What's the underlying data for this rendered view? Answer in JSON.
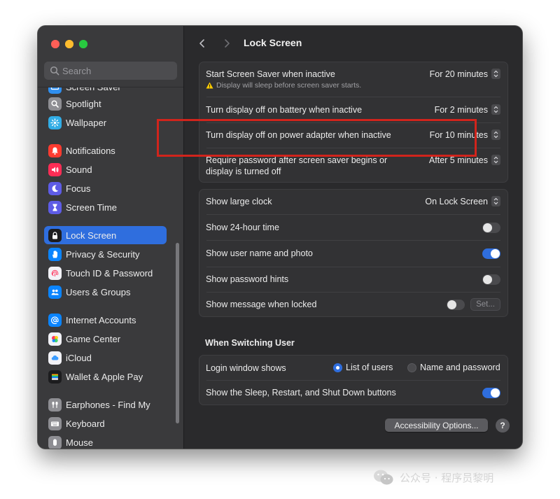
{
  "sidebar": {
    "search_placeholder": "Search",
    "items": [
      {
        "label": "Screen Saver",
        "icon": "screen-saver-icon",
        "color": "#2f8ff0"
      },
      {
        "label": "Spotlight",
        "icon": "spotlight-icon",
        "color": "#8e8e93"
      },
      {
        "label": "Wallpaper",
        "icon": "wallpaper-icon",
        "color": "#32ade6"
      },
      {
        "label": "Notifications",
        "icon": "bell-icon",
        "color": "#ff3b30"
      },
      {
        "label": "Sound",
        "icon": "speaker-icon",
        "color": "#ff2d55"
      },
      {
        "label": "Focus",
        "icon": "moon-icon",
        "color": "#5e5ce6"
      },
      {
        "label": "Screen Time",
        "icon": "hourglass-icon",
        "color": "#5e5ce6"
      },
      {
        "label": "Lock Screen",
        "icon": "lock-icon",
        "color": "#1c1c1e"
      },
      {
        "label": "Privacy & Security",
        "icon": "hand-icon",
        "color": "#0a84ff"
      },
      {
        "label": "Touch ID & Password",
        "icon": "fingerprint-icon",
        "color": "#f2f2f7"
      },
      {
        "label": "Users & Groups",
        "icon": "users-icon",
        "color": "#0a84ff"
      },
      {
        "label": "Internet Accounts",
        "icon": "at-icon",
        "color": "#0a84ff"
      },
      {
        "label": "Game Center",
        "icon": "game-center-icon",
        "color": "#f2f2f7"
      },
      {
        "label": "iCloud",
        "icon": "cloud-icon",
        "color": "#f2f2f7"
      },
      {
        "label": "Wallet & Apple Pay",
        "icon": "wallet-icon",
        "color": "#1c1c1e"
      },
      {
        "label": "Earphones - Find My",
        "icon": "earphones-icon",
        "color": "#8e8e93"
      },
      {
        "label": "Keyboard",
        "icon": "keyboard-icon",
        "color": "#8e8e93"
      },
      {
        "label": "Mouse",
        "icon": "mouse-icon",
        "color": "#8e8e93"
      }
    ]
  },
  "header": {
    "title": "Lock Screen"
  },
  "group1": {
    "screen_saver": {
      "label": "Start Screen Saver when inactive",
      "warning": "Display will sleep before screen saver starts.",
      "value": "For 20 minutes"
    },
    "battery": {
      "label": "Turn display off on battery when inactive",
      "value": "For 2 minutes"
    },
    "adapter": {
      "label": "Turn display off on power adapter when inactive",
      "value": "For 10 minutes"
    },
    "password": {
      "label_line1": "Require password after screen saver begins or",
      "label_line2": "display is turned off",
      "value": "After 5 minutes"
    }
  },
  "group2": {
    "large_clock": {
      "label": "Show large clock",
      "value": "On Lock Screen"
    },
    "hour24": {
      "label": "Show 24-hour time",
      "on": false
    },
    "user_photo": {
      "label": "Show user name and photo",
      "on": true
    },
    "hints": {
      "label": "Show password hints",
      "on": false
    },
    "message": {
      "label": "Show message when locked",
      "on": false,
      "button": "Set..."
    }
  },
  "switching": {
    "title": "When Switching User",
    "login_window": {
      "label": "Login window shows",
      "option1": "List of users",
      "option2": "Name and password",
      "selected": "option1"
    },
    "buttons": {
      "label": "Show the Sleep, Restart, and Shut Down buttons",
      "on": true
    }
  },
  "footer": {
    "accessibility": "Accessibility Options...",
    "help": "?"
  },
  "watermark": {
    "text": "公众号 · 程序员黎明"
  },
  "colors": {
    "accent": "#2f6ede",
    "highlight": "#d1241c"
  }
}
